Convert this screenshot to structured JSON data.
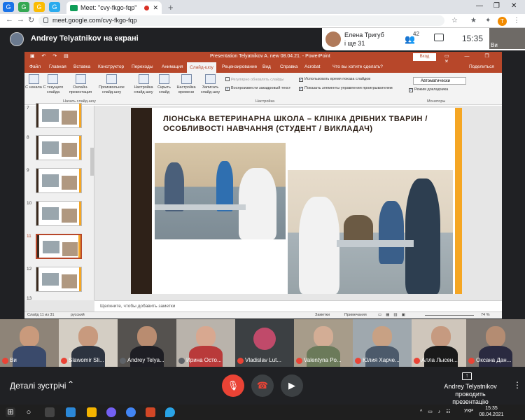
{
  "browser": {
    "tab_title": "Meet: \"cvy-fkgo-fqp\"",
    "new_tab": "+",
    "url": "meet.google.com/cvy-fkgo-fqp",
    "profile_initial": "T",
    "pinned": [
      "G",
      "G",
      "G",
      "G"
    ]
  },
  "meet": {
    "presenting_label": "Andrey Telyatnikov на екрані",
    "notification_name": "Елена Тригуб",
    "notification_more": "і ще 31",
    "people_count": "42",
    "clock": "15:35",
    "self_label": "Ви",
    "participants": [
      {
        "name": "Ви",
        "face": "#d9b49a",
        "body": "#3a4a6b"
      },
      {
        "name": "Slawomir Sli...",
        "face": "#c89a7e",
        "body": "#2d3440"
      },
      {
        "name": "Andrey Telya...",
        "face": "#b98c70",
        "body": "#1e1e24"
      },
      {
        "name": "Ирина Осто...",
        "face": "#d8a890",
        "body": "#b93a3a"
      },
      {
        "name": "Vladislav Lut...",
        "face": "#c04a6a",
        "body": "#2a1a20"
      },
      {
        "name": "Valentyna Po...",
        "face": "#d3ad95",
        "body": "#6b7a5a"
      },
      {
        "name": "Юлия Харче...",
        "face": "#c8a184",
        "body": "#4c5a6b"
      },
      {
        "name": "Алла Лысен...",
        "face": "#c69a80",
        "body": "#1a1a1a"
      },
      {
        "name": "Оксана Дан...",
        "face": "#b48c72",
        "body": "#2a2a40"
      }
    ],
    "details_label": "Деталі зустрічі",
    "presenter_name": "Andrey Telyatnikov",
    "presenter_status": "проводить презентацію"
  },
  "ppt": {
    "title": "Presentation Telyatnikov A.  new 08.04.21.  -  PowerPoint",
    "login": "Вход",
    "tabs": [
      "Файл",
      "Главная",
      "Вставка",
      "Конструктор",
      "Переходы",
      "Анимация",
      "Слайд-шоу",
      "Рецензирование",
      "Вид",
      "Справка",
      "Acrobat",
      "Что вы хотите сделать?",
      "Поделиться"
    ],
    "active_tab": "Слайд-шоу",
    "ribbon": {
      "from_start": "С начала",
      "from_current": "С текущего слайда",
      "online": "Онлайн-презентация",
      "custom": "Произвольное слайд-шоу",
      "group_start": "Начать слайд-шоу",
      "setup": "Настройка слайд-шоу",
      "hide": "Скрыть слайд",
      "rehearse": "Настройка времени",
      "record": "Записать слайд-шоу",
      "group_setup": "Настройка",
      "chk_update": "Регулярно обновлять слайды",
      "chk_narration": "Воспроизвести закадровый текст",
      "chk_timings": "Использовать время показа слайдов",
      "chk_controls": "Показать элементы управления проигрывателем",
      "monitor": "Автоматически",
      "presenter_view": "Режим докладчика",
      "group_monitors": "Мониторы"
    },
    "slide_numbers": [
      "7",
      "8",
      "9",
      "10",
      "11",
      "12",
      "13"
    ],
    "active_slide": "11",
    "slide_title": "ЛІОНСЬКА ВЕТЕРИНАРНА ШКОЛА – КЛІНІКА ДРІБНИХ ТВАРИН  /ОСОБЛИВОСТІ НАВЧАННЯ (СТУДЕНТ / ВИКЛАДАЧ)",
    "notes_placeholder": "Щелкните, чтобы добавить заметки",
    "status_slide": "Слайд 11 из 31",
    "status_lang": "русский",
    "status_notes": "Заметки",
    "status_comments": "Примечания",
    "zoom": "74 %"
  },
  "taskbar": {
    "lang": "УКР",
    "time": "15:35",
    "date": "08.04.2021"
  }
}
